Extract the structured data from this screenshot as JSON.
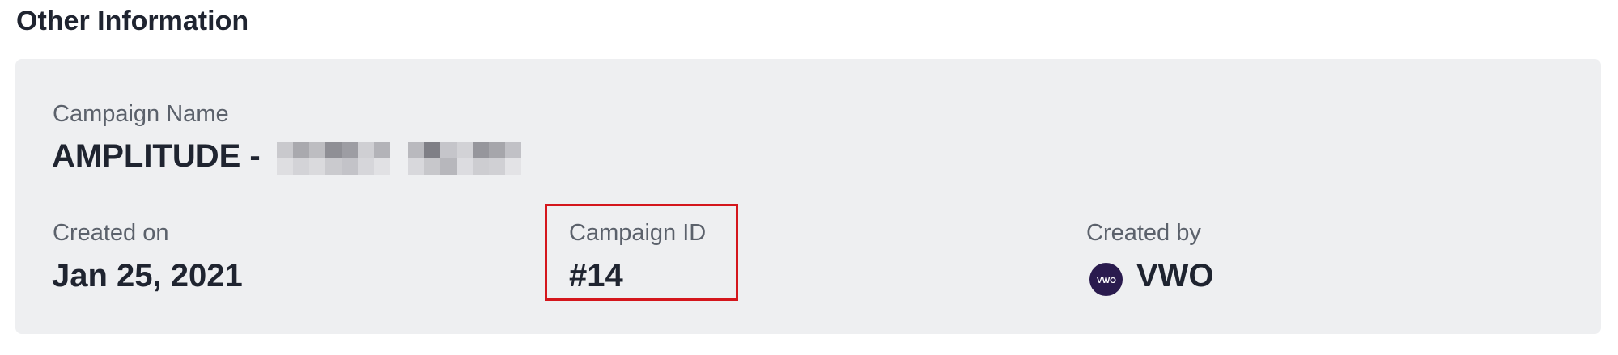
{
  "section": {
    "title": "Other Information"
  },
  "campaign": {
    "name_label": "Campaign Name",
    "name_value": "AMPLITUDE -",
    "created_on_label": "Created on",
    "created_on_value": "Jan 25, 2021",
    "id_label": "Campaign ID",
    "id_value": "#14",
    "created_by_label": "Created by",
    "created_by_value": "VWO",
    "created_by_icon": "vwo-logo-icon"
  },
  "colors": {
    "card_background": "#eeeff1",
    "highlight_border": "#d4161c",
    "vwo_logo_bg": "#2a1b4e"
  }
}
